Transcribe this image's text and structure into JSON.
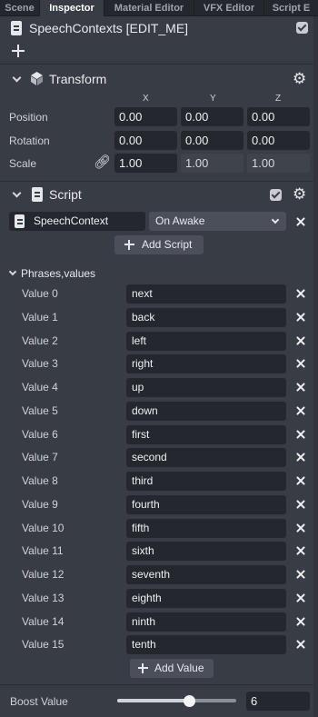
{
  "tabs": [
    "Scene",
    "Inspector",
    "Material Editor",
    "VFX Editor",
    "Script E"
  ],
  "object": {
    "name": "SpeechContexts [EDIT_ME]",
    "enabled": true
  },
  "transform": {
    "title": "Transform",
    "axes": [
      "X",
      "Y",
      "Z"
    ],
    "rows": [
      {
        "label": "Position",
        "values": [
          "0.00",
          "0.00",
          "0.00"
        ]
      },
      {
        "label": "Rotation",
        "values": [
          "0.00",
          "0.00",
          "0.00"
        ]
      },
      {
        "label": "Scale",
        "values": [
          "1.00",
          "1.00",
          "1.00"
        ]
      }
    ]
  },
  "script": {
    "title": "Script",
    "enabled": true,
    "asset": "SpeechContext",
    "event": "On Awake",
    "add_label": "Add Script"
  },
  "phrases": {
    "title": "Phrases,values",
    "items": [
      {
        "label": "Value 0",
        "value": "next"
      },
      {
        "label": "Value 1",
        "value": "back"
      },
      {
        "label": "Value 2",
        "value": "left"
      },
      {
        "label": "Value 3",
        "value": "right"
      },
      {
        "label": "Value 4",
        "value": "up"
      },
      {
        "label": "Value 5",
        "value": "down"
      },
      {
        "label": "Value 6",
        "value": "first"
      },
      {
        "label": "Value 7",
        "value": "second"
      },
      {
        "label": "Value 8",
        "value": "third"
      },
      {
        "label": "Value 9",
        "value": "fourth"
      },
      {
        "label": "Value 10",
        "value": "fifth"
      },
      {
        "label": "Value 11",
        "value": "sixth"
      },
      {
        "label": "Value 12",
        "value": "seventh"
      },
      {
        "label": "Value 13",
        "value": "eighth"
      },
      {
        "label": "Value 14",
        "value": "ninth"
      },
      {
        "label": "Value 15",
        "value": "tenth"
      }
    ],
    "add_label": "Add Value"
  },
  "boost": {
    "label": "Boost Value",
    "value": "6",
    "slider_fraction": 0.6
  },
  "icons": {
    "object": "script-file-icon",
    "add": "plus-icon",
    "transform": "transform-cube-icon",
    "settings": "gear-icon",
    "link": "link-icon",
    "remove": "close-icon",
    "collapse": "chevron-down-icon"
  },
  "colors": {
    "panel": "#383c45",
    "field": "#24272d",
    "tabbar": "#24272d",
    "button": "#4a4f59"
  }
}
